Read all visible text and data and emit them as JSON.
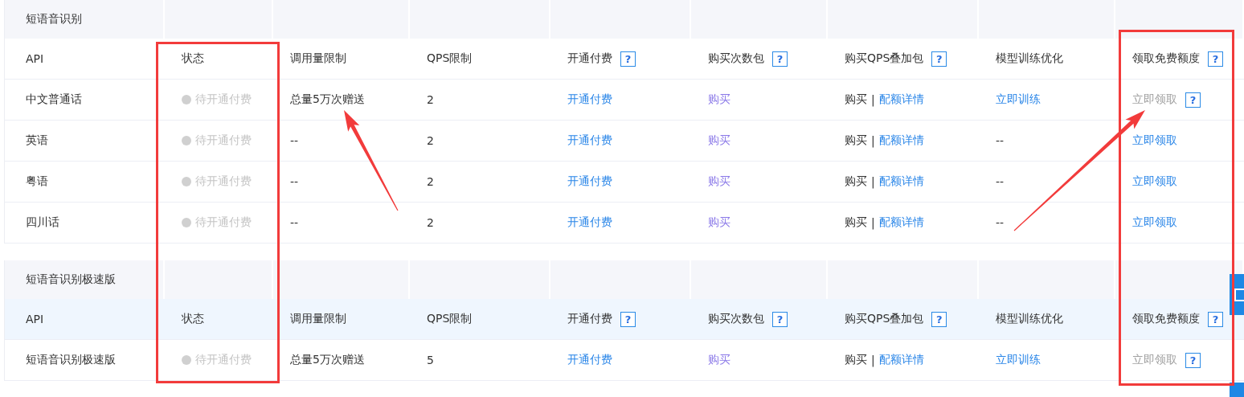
{
  "sections": [
    {
      "title": "短语音识别",
      "header_hovered": false,
      "columns": [
        {
          "label": "API"
        },
        {
          "label": "状态"
        },
        {
          "label": "调用量限制"
        },
        {
          "label": "QPS限制"
        },
        {
          "label": "开通付费",
          "help": "?"
        },
        {
          "label": "购买次数包",
          "help": "?"
        },
        {
          "label": "购买QPS叠加包",
          "help": "?"
        },
        {
          "label": "模型训练优化"
        },
        {
          "label": "领取免费额度",
          "help": "?"
        }
      ],
      "rows": [
        {
          "cells": [
            {
              "parts": [
                {
                  "kind": "text",
                  "text": "中文普通话"
                }
              ]
            },
            {
              "parts": [
                {
                  "kind": "status",
                  "text": "待开通付费"
                }
              ]
            },
            {
              "parts": [
                {
                  "kind": "text",
                  "text": "总量5万次赠送"
                }
              ]
            },
            {
              "parts": [
                {
                  "kind": "text",
                  "text": "2"
                }
              ]
            },
            {
              "parts": [
                {
                  "kind": "link",
                  "text": "开通付费"
                }
              ]
            },
            {
              "parts": [
                {
                  "kind": "visited",
                  "text": "购买"
                }
              ]
            },
            {
              "parts": [
                {
                  "kind": "text",
                  "text": "购买"
                },
                {
                  "kind": "separator",
                  "text": "|"
                },
                {
                  "kind": "link",
                  "text": "配额详情"
                }
              ]
            },
            {
              "parts": [
                {
                  "kind": "link",
                  "text": "立即训练"
                }
              ]
            },
            {
              "parts": [
                {
                  "kind": "disabled",
                  "text": "立即领取"
                },
                {
                  "kind": "help",
                  "text": "?"
                }
              ]
            }
          ]
        },
        {
          "cells": [
            {
              "parts": [
                {
                  "kind": "text",
                  "text": "英语"
                }
              ]
            },
            {
              "parts": [
                {
                  "kind": "status",
                  "text": "待开通付费"
                }
              ]
            },
            {
              "parts": [
                {
                  "kind": "text",
                  "text": "--"
                }
              ]
            },
            {
              "parts": [
                {
                  "kind": "text",
                  "text": "2"
                }
              ]
            },
            {
              "parts": [
                {
                  "kind": "link",
                  "text": "开通付费"
                }
              ]
            },
            {
              "parts": [
                {
                  "kind": "visited",
                  "text": "购买"
                }
              ]
            },
            {
              "parts": [
                {
                  "kind": "text",
                  "text": "购买"
                },
                {
                  "kind": "separator",
                  "text": "|"
                },
                {
                  "kind": "link",
                  "text": "配额详情"
                }
              ]
            },
            {
              "parts": [
                {
                  "kind": "text",
                  "text": "--"
                }
              ]
            },
            {
              "parts": [
                {
                  "kind": "link",
                  "text": "立即领取"
                }
              ]
            }
          ]
        },
        {
          "cells": [
            {
              "parts": [
                {
                  "kind": "text",
                  "text": "粤语"
                }
              ]
            },
            {
              "parts": [
                {
                  "kind": "status",
                  "text": "待开通付费"
                }
              ]
            },
            {
              "parts": [
                {
                  "kind": "text",
                  "text": "--"
                }
              ]
            },
            {
              "parts": [
                {
                  "kind": "text",
                  "text": "2"
                }
              ]
            },
            {
              "parts": [
                {
                  "kind": "link",
                  "text": "开通付费"
                }
              ]
            },
            {
              "parts": [
                {
                  "kind": "visited",
                  "text": "购买"
                }
              ]
            },
            {
              "parts": [
                {
                  "kind": "text",
                  "text": "购买"
                },
                {
                  "kind": "separator",
                  "text": "|"
                },
                {
                  "kind": "link",
                  "text": "配额详情"
                }
              ]
            },
            {
              "parts": [
                {
                  "kind": "text",
                  "text": "--"
                }
              ]
            },
            {
              "parts": [
                {
                  "kind": "link",
                  "text": "立即领取"
                }
              ]
            }
          ]
        },
        {
          "cells": [
            {
              "parts": [
                {
                  "kind": "text",
                  "text": "四川话"
                }
              ]
            },
            {
              "parts": [
                {
                  "kind": "status",
                  "text": "待开通付费"
                }
              ]
            },
            {
              "parts": [
                {
                  "kind": "text",
                  "text": "--"
                }
              ]
            },
            {
              "parts": [
                {
                  "kind": "text",
                  "text": "2"
                }
              ]
            },
            {
              "parts": [
                {
                  "kind": "link",
                  "text": "开通付费"
                }
              ]
            },
            {
              "parts": [
                {
                  "kind": "visited",
                  "text": "购买"
                }
              ]
            },
            {
              "parts": [
                {
                  "kind": "text",
                  "text": "购买"
                },
                {
                  "kind": "separator",
                  "text": "|"
                },
                {
                  "kind": "link",
                  "text": "配额详情"
                }
              ]
            },
            {
              "parts": [
                {
                  "kind": "text",
                  "text": "--"
                }
              ]
            },
            {
              "parts": [
                {
                  "kind": "link",
                  "text": "立即领取"
                }
              ]
            }
          ]
        }
      ]
    },
    {
      "title": "短语音识别极速版",
      "header_hovered": true,
      "columns": [
        {
          "label": "API"
        },
        {
          "label": "状态"
        },
        {
          "label": "调用量限制"
        },
        {
          "label": "QPS限制"
        },
        {
          "label": "开通付费",
          "help": "?"
        },
        {
          "label": "购买次数包",
          "help": "?"
        },
        {
          "label": "购买QPS叠加包",
          "help": "?"
        },
        {
          "label": "模型训练优化"
        },
        {
          "label": "领取免费额度",
          "help": "?"
        }
      ],
      "rows": [
        {
          "cells": [
            {
              "parts": [
                {
                  "kind": "text",
                  "text": "短语音识别极速版"
                }
              ]
            },
            {
              "parts": [
                {
                  "kind": "status",
                  "text": "待开通付费"
                }
              ]
            },
            {
              "parts": [
                {
                  "kind": "text",
                  "text": "总量5万次赠送"
                }
              ]
            },
            {
              "parts": [
                {
                  "kind": "text",
                  "text": "5"
                }
              ]
            },
            {
              "parts": [
                {
                  "kind": "link",
                  "text": "开通付费"
                }
              ]
            },
            {
              "parts": [
                {
                  "kind": "visited",
                  "text": "购买"
                }
              ]
            },
            {
              "parts": [
                {
                  "kind": "text",
                  "text": "购买"
                },
                {
                  "kind": "separator",
                  "text": "|"
                },
                {
                  "kind": "link",
                  "text": "配额详情"
                }
              ]
            },
            {
              "parts": [
                {
                  "kind": "link",
                  "text": "立即训练"
                }
              ]
            },
            {
              "parts": [
                {
                  "kind": "disabled",
                  "text": "立即领取"
                },
                {
                  "kind": "help",
                  "text": "?"
                }
              ]
            }
          ]
        }
      ]
    }
  ]
}
